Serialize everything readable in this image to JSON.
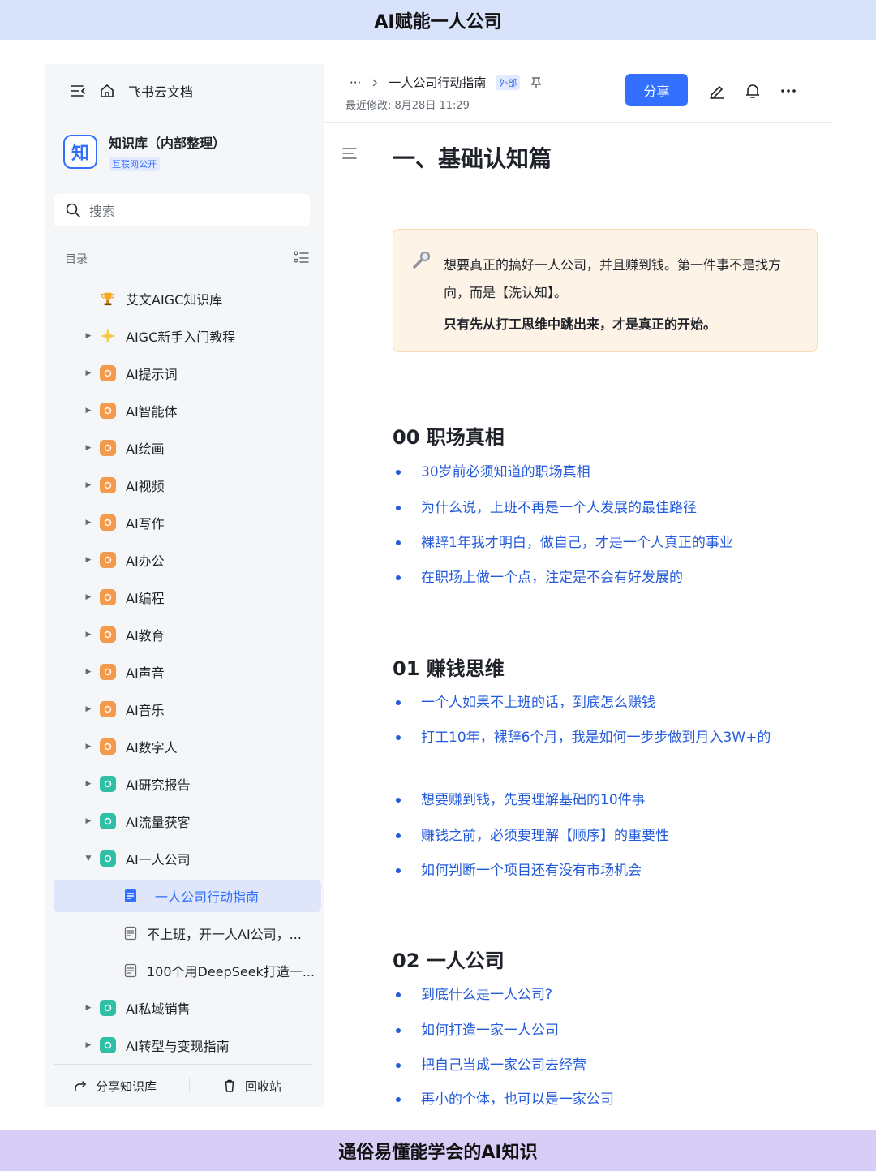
{
  "top_banner": "AI赋能一人公司",
  "bottom_banner": "通俗易懂能学会的AI知识",
  "sidebar": {
    "app_name": "飞书云文档",
    "kb_logo_char": "知",
    "kb_name": "知识库（内部整理）",
    "kb_badge": "互联网公开",
    "search_placeholder": "搜索",
    "toc_label": "目录",
    "items": [
      {
        "label": "艾文AIGC知识库",
        "icon": "trophy-icon",
        "color": "#f5a623"
      },
      {
        "label": "AIGC新手入门教程",
        "icon": "sparkle-icon",
        "color": "#f7c948"
      },
      {
        "label": "AI提示词",
        "icon": "app-icon",
        "color": "#f39a4c"
      },
      {
        "label": "AI智能体",
        "icon": "app-icon",
        "color": "#f39a4c"
      },
      {
        "label": "AI绘画",
        "icon": "app-icon",
        "color": "#f39a4c"
      },
      {
        "label": "AI视频",
        "icon": "app-icon",
        "color": "#f39a4c"
      },
      {
        "label": "AI写作",
        "icon": "app-icon",
        "color": "#f39a4c"
      },
      {
        "label": "AI办公",
        "icon": "app-icon",
        "color": "#f39a4c"
      },
      {
        "label": "AI编程",
        "icon": "app-icon",
        "color": "#f39a4c"
      },
      {
        "label": "AI教育",
        "icon": "app-icon",
        "color": "#f39a4c"
      },
      {
        "label": "AI声音",
        "icon": "app-icon",
        "color": "#f39a4c"
      },
      {
        "label": "AI音乐",
        "icon": "app-icon",
        "color": "#f39a4c"
      },
      {
        "label": "AI数字人",
        "icon": "app-icon",
        "color": "#f39a4c"
      },
      {
        "label": "AI研究报告",
        "icon": "app-icon",
        "color": "#2ebfa5"
      },
      {
        "label": "AI流量获客",
        "icon": "app-icon",
        "color": "#2ebfa5"
      },
      {
        "label": "AI一人公司",
        "icon": "app-icon",
        "color": "#2ebfa5"
      },
      {
        "label": "一人公司行动指南",
        "icon": "doc-icon",
        "color": "#3370ff"
      },
      {
        "label": "不上班，开一人AI公司，...",
        "icon": "doc-icon",
        "color": "#646a73"
      },
      {
        "label": "100个用DeepSeek打造一...",
        "icon": "doc-icon",
        "color": "#646a73"
      },
      {
        "label": "AI私域销售",
        "icon": "app-icon",
        "color": "#2ebfa5"
      },
      {
        "label": "AI转型与变现指南",
        "icon": "app-icon",
        "color": "#2ebfa5"
      }
    ],
    "footer_share": "分享知识库",
    "footer_trash": "回收站"
  },
  "main": {
    "breadcrumb_more": "···",
    "breadcrumb_title": "一人公司行动指南",
    "external_badge": "外部",
    "modified": "最近修改: 8月28日 11:29",
    "share_label": "分享",
    "doc_title": "一、基础认知篇",
    "callout_line1": "想要真正的搞好一人公司，并且赚到钱。第一件事不是找方向，而是【洗认知】。",
    "callout_line2": "只有先从打工思维中跳出来，才是真正的开始。",
    "sections": [
      {
        "heading": "00 职场真相",
        "bullets": [
          "30岁前必须知道的职场真相",
          "为什么说，上班不再是一个人发展的最佳路径",
          "裸辞1年我才明白，做自己，才是一个人真正的事业",
          "在职场上做一个点，注定是不会有好发展的"
        ]
      },
      {
        "heading": "01 赚钱思维",
        "bullets": [
          "一个人如果不上班的话，到底怎么赚钱",
          "打工10年，裸辞6个月，我是如何一步步做到月入3W+的",
          "想要赚到钱，先要理解基础的10件事",
          "赚钱之前，必须要理解【顺序】的重要性",
          "如何判断一个项目还有没有市场机会"
        ]
      },
      {
        "heading": "02 一人公司",
        "bullets": [
          "到底什么是一人公司?",
          "如何打造一家一人公司",
          "把自己当成一家公司去经营",
          "再小的个体，也可以是一家公司"
        ]
      }
    ]
  }
}
